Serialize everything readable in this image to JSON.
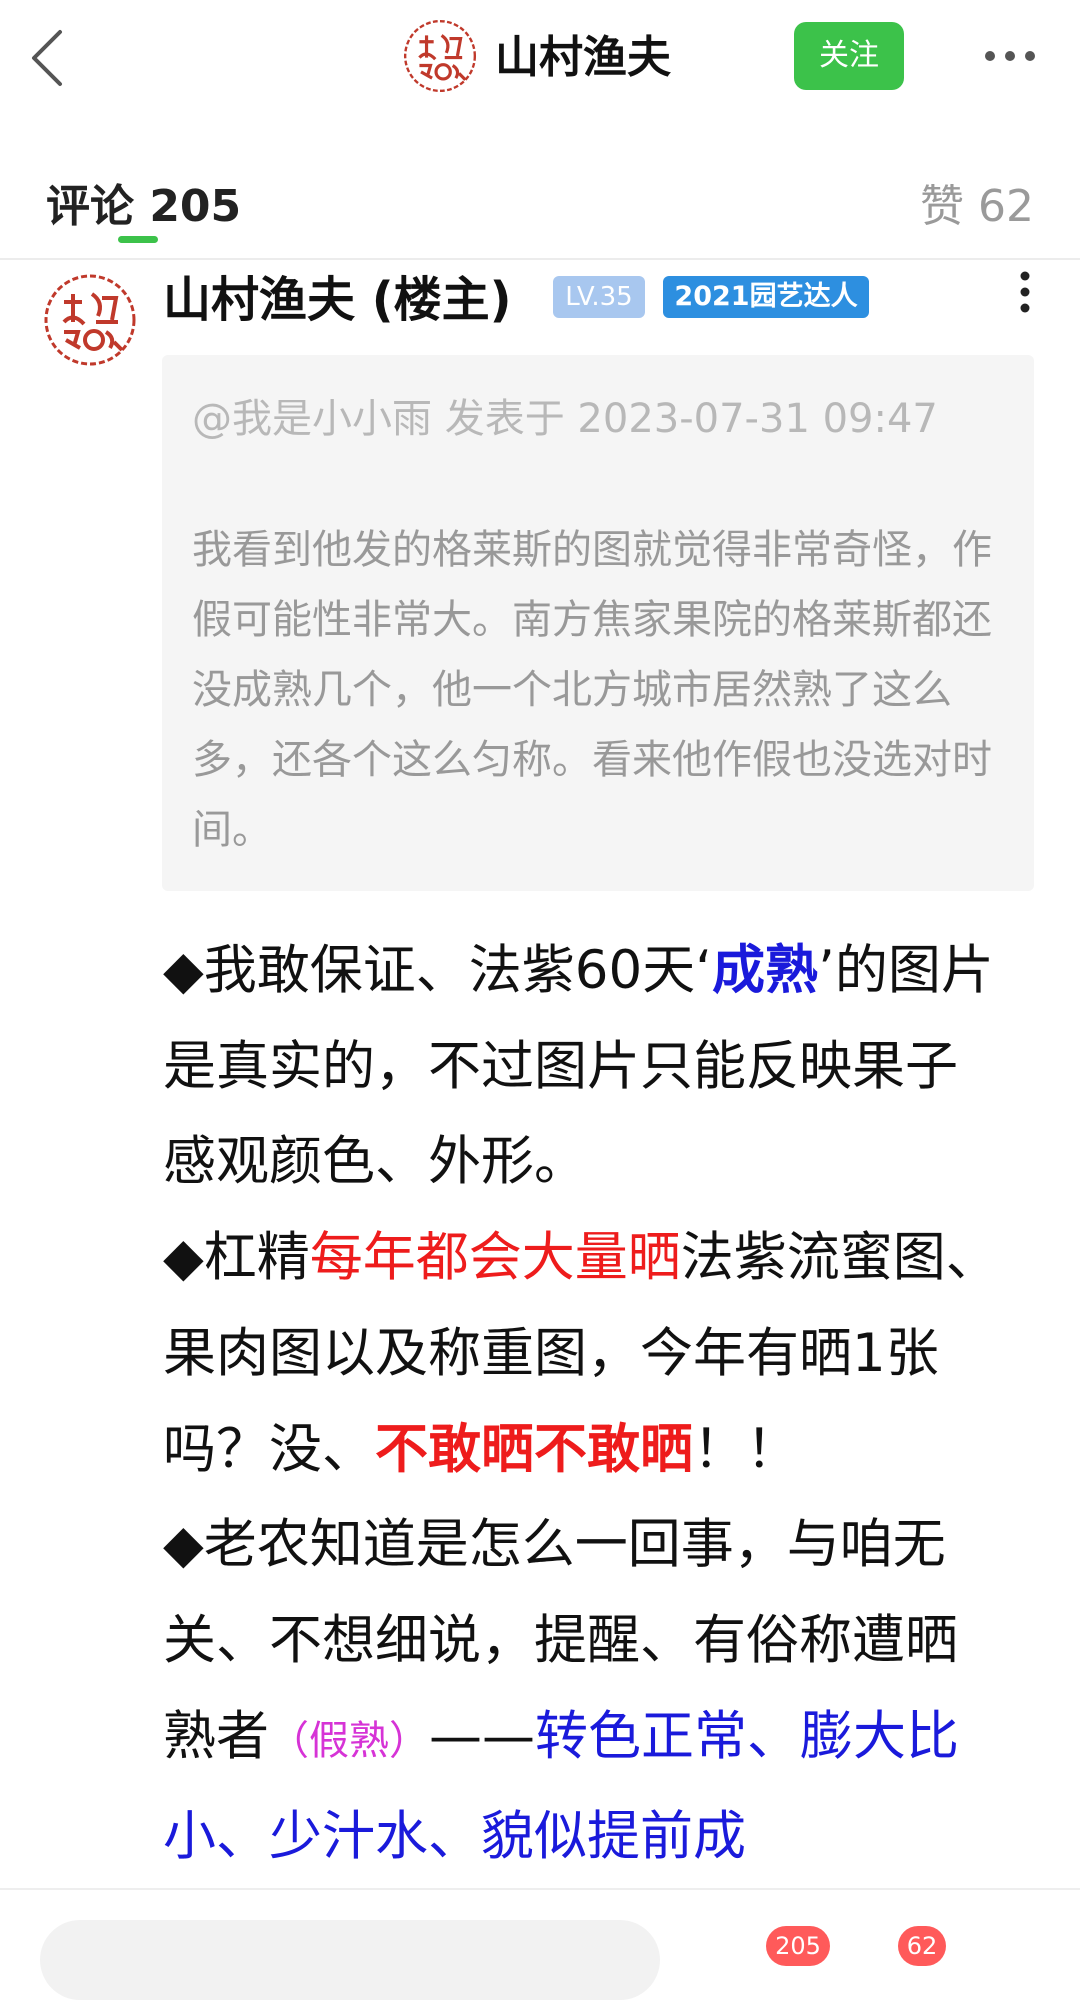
{
  "header": {
    "author": "山村渔夫",
    "follow_label": "关注"
  },
  "tabs": {
    "comments_label": "评论 205",
    "likes_label": "赞 62"
  },
  "comment": {
    "author": "山村渔夫 (楼主)",
    "level": "LV.35",
    "title_badge": "2021园艺达人",
    "quote": {
      "meta": "@我是小小雨 发表于 2023-07-31 09:47",
      "text": "我看到他发的格莱斯的图就觉得非常奇怪，作假可能性非常大。南方焦家果院的格莱斯都还没成熟几个，他一个北方城市居然熟了这么多，还各个这么匀称。看来他作假也没选对时间。"
    },
    "body": {
      "p1_a": "◆我敢保证、法紫60天‘",
      "p1_b": "成熟",
      "p1_c": "’的图片是真实的，不过图片只能反映果子感观颜色、外形。",
      "p2_a": "◆杠精",
      "p2_b": "每年都会大量晒",
      "p2_c": "法紫流蜜图、果肉图以及称重图，今年有晒1张吗？没、",
      "p2_d": "不敢晒不敢晒",
      "p2_e": "！！",
      "p3_a": "◆老农知道是怎么一回事，与咱无关、不想细说，提醒、有俗称遭晒熟者",
      "p3_b": "（假熟）",
      "p3_c": "——",
      "p3_d": "转色正常、膨大比小、少汁水、貌似提前成"
    }
  },
  "bottom": {
    "comment_count": "205",
    "like_count": "62"
  },
  "colors": {
    "accent_green": "#3cc24a",
    "seal_red": "#c0392b",
    "highlight_blue": "#1a1adb",
    "highlight_red": "#ee1c1c",
    "highlight_magenta": "#d633d6"
  }
}
